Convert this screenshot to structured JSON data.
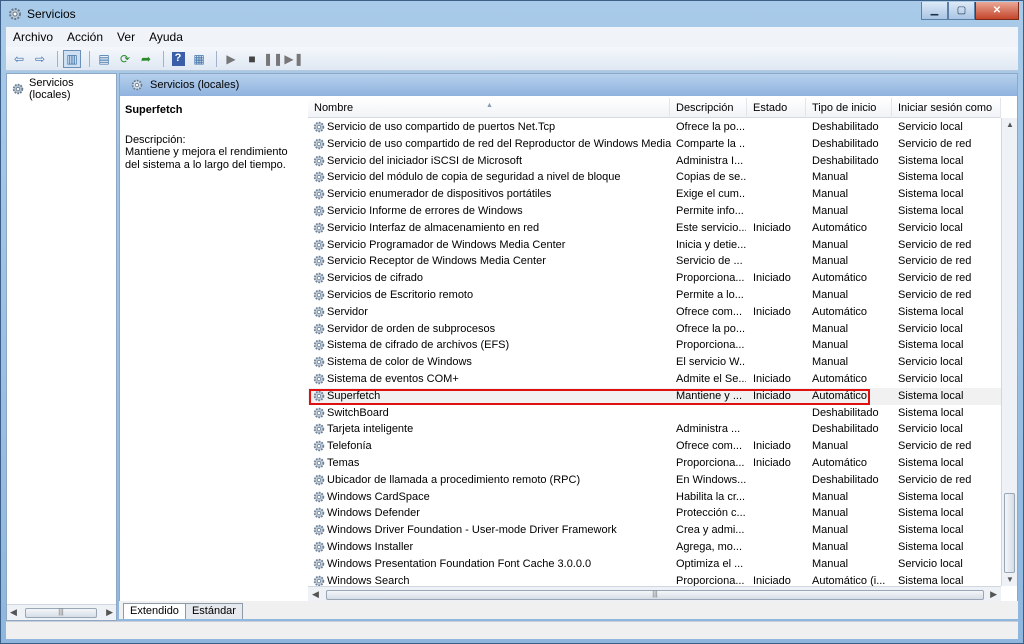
{
  "window": {
    "title": "Servicios"
  },
  "menu": [
    "Archivo",
    "Acción",
    "Ver",
    "Ayuda"
  ],
  "tree": {
    "root_label": "Servicios (locales)"
  },
  "pane": {
    "header": "Servicios (locales)"
  },
  "detail": {
    "service_name": "Superfetch",
    "description_label": "Descripción:",
    "description_text": "Mantiene y mejora el rendimiento del sistema a lo largo del tiempo."
  },
  "columns": {
    "name": "Nombre",
    "description": "Descripción",
    "state": "Estado",
    "startup": "Tipo de inicio",
    "logon": "Iniciar sesión como"
  },
  "services": [
    {
      "name": "Servicio de uso compartido de puertos Net.Tcp",
      "description": "Ofrece la po...",
      "state": "",
      "startup": "Deshabilitado",
      "logon": "Servicio local"
    },
    {
      "name": "Servicio de uso compartido de red del Reproductor de Windows Media",
      "description": "Comparte la ...",
      "state": "",
      "startup": "Deshabilitado",
      "logon": "Servicio de red"
    },
    {
      "name": "Servicio del iniciador iSCSI de Microsoft",
      "description": "Administra I...",
      "state": "",
      "startup": "Deshabilitado",
      "logon": "Sistema local"
    },
    {
      "name": "Servicio del módulo de copia de seguridad a nivel de bloque",
      "description": "Copias de se...",
      "state": "",
      "startup": "Manual",
      "logon": "Sistema local"
    },
    {
      "name": "Servicio enumerador de dispositivos portátiles",
      "description": "Exige el cum...",
      "state": "",
      "startup": "Manual",
      "logon": "Sistema local"
    },
    {
      "name": "Servicio Informe de errores de Windows",
      "description": "Permite info...",
      "state": "",
      "startup": "Manual",
      "logon": "Sistema local"
    },
    {
      "name": "Servicio Interfaz de almacenamiento en red",
      "description": "Este servicio...",
      "state": "Iniciado",
      "startup": "Automático",
      "logon": "Servicio local"
    },
    {
      "name": "Servicio Programador de Windows Media Center",
      "description": "Inicia y detie...",
      "state": "",
      "startup": "Manual",
      "logon": "Servicio de red"
    },
    {
      "name": "Servicio Receptor de Windows Media Center",
      "description": "Servicio de ...",
      "state": "",
      "startup": "Manual",
      "logon": "Servicio de red"
    },
    {
      "name": "Servicios de cifrado",
      "description": "Proporciona...",
      "state": "Iniciado",
      "startup": "Automático",
      "logon": "Servicio de red"
    },
    {
      "name": "Servicios de Escritorio remoto",
      "description": "Permite a lo...",
      "state": "",
      "startup": "Manual",
      "logon": "Servicio de red"
    },
    {
      "name": "Servidor",
      "description": "Ofrece com...",
      "state": "Iniciado",
      "startup": "Automático",
      "logon": "Sistema local"
    },
    {
      "name": "Servidor de orden de subprocesos",
      "description": "Ofrece la po...",
      "state": "",
      "startup": "Manual",
      "logon": "Servicio local"
    },
    {
      "name": "Sistema de cifrado de archivos (EFS)",
      "description": "Proporciona...",
      "state": "",
      "startup": "Manual",
      "logon": "Sistema local"
    },
    {
      "name": "Sistema de color de Windows",
      "description": "El servicio W...",
      "state": "",
      "startup": "Manual",
      "logon": "Servicio local"
    },
    {
      "name": "Sistema de eventos COM+",
      "description": "Admite el Se...",
      "state": "Iniciado",
      "startup": "Automático",
      "logon": "Servicio local"
    },
    {
      "name": "Superfetch",
      "description": "Mantiene y ...",
      "state": "Iniciado",
      "startup": "Automático",
      "logon": "Sistema local"
    },
    {
      "name": "SwitchBoard",
      "description": "",
      "state": "",
      "startup": "Deshabilitado",
      "logon": "Sistema local"
    },
    {
      "name": "Tarjeta inteligente",
      "description": "Administra ...",
      "state": "",
      "startup": "Deshabilitado",
      "logon": "Servicio local"
    },
    {
      "name": "Telefonía",
      "description": "Ofrece com...",
      "state": "Iniciado",
      "startup": "Manual",
      "logon": "Servicio de red"
    },
    {
      "name": "Temas",
      "description": "Proporciona...",
      "state": "Iniciado",
      "startup": "Automático",
      "logon": "Sistema local"
    },
    {
      "name": "Ubicador de llamada a procedimiento remoto (RPC)",
      "description": "En Windows...",
      "state": "",
      "startup": "Deshabilitado",
      "logon": "Servicio de red"
    },
    {
      "name": "Windows CardSpace",
      "description": "Habilita la cr...",
      "state": "",
      "startup": "Manual",
      "logon": "Sistema local"
    },
    {
      "name": "Windows Defender",
      "description": "Protección c...",
      "state": "",
      "startup": "Manual",
      "logon": "Sistema local"
    },
    {
      "name": "Windows Driver Foundation - User-mode Driver Framework",
      "description": "Crea y admi...",
      "state": "",
      "startup": "Manual",
      "logon": "Sistema local"
    },
    {
      "name": "Windows Installer",
      "description": "Agrega, mo...",
      "state": "",
      "startup": "Manual",
      "logon": "Sistema local"
    },
    {
      "name": "Windows Presentation Foundation Font Cache 3.0.0.0",
      "description": "Optimiza el ...",
      "state": "",
      "startup": "Manual",
      "logon": "Servicio local"
    },
    {
      "name": "Windows Search",
      "description": "Proporciona...",
      "state": "Iniciado",
      "startup": "Automático (i...",
      "logon": "Sistema local"
    }
  ],
  "selected_service": "Superfetch",
  "tabs": [
    "Extendido",
    "Estándar"
  ],
  "active_tab": "Extendido",
  "colors": {
    "highlight_border": "#e01010",
    "header_blue": "#8fb2dd"
  }
}
